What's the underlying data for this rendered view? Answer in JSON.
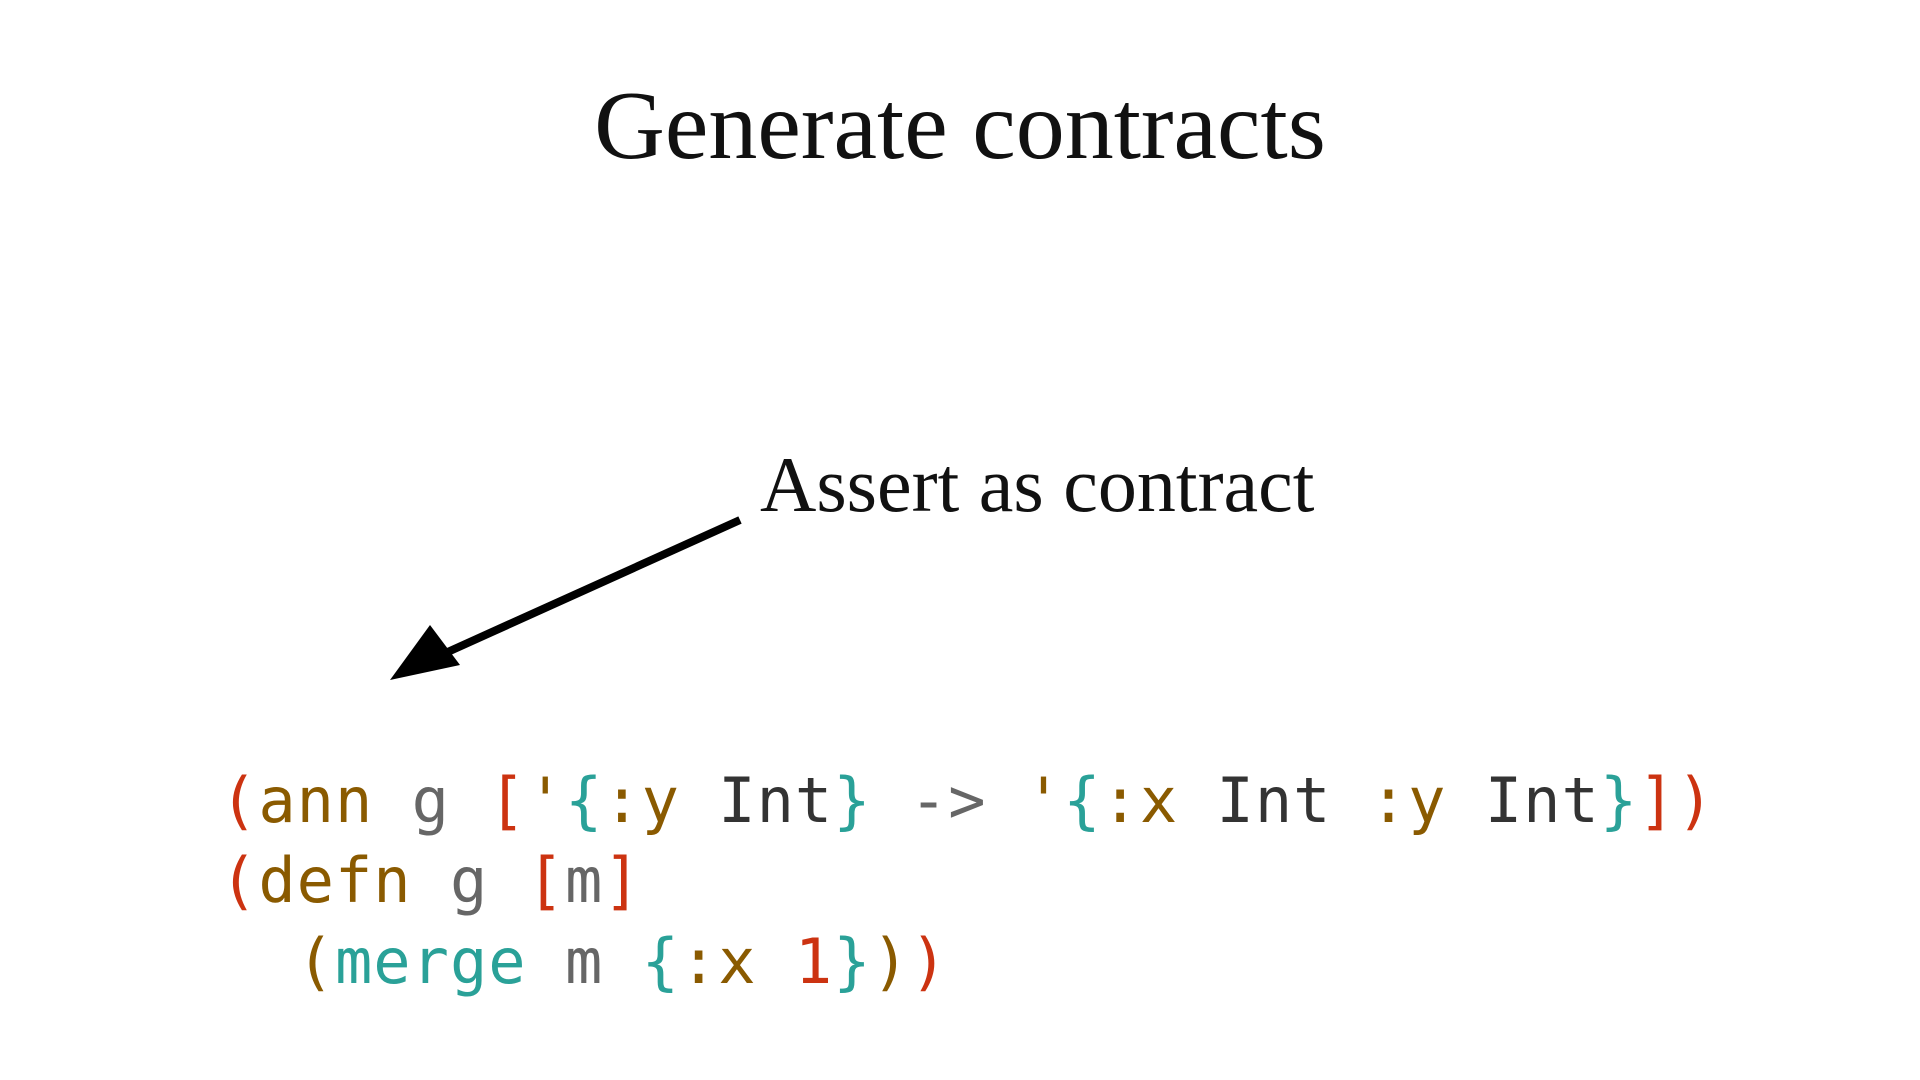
{
  "title": "Generate contracts",
  "annotation": "Assert as contract",
  "code": {
    "line1": {
      "p1": "(",
      "p2": "ann",
      "p3": " g ",
      "p4": "[",
      "p5": "'",
      "p6": "{",
      "p7": ":y",
      "p8": " Int",
      "p9": "}",
      "p10": " -> ",
      "p11": "'",
      "p12": "{",
      "p13": ":x",
      "p14": " Int ",
      "p15": ":y",
      "p16": " Int",
      "p17": "}",
      "p18": "]",
      "p19": ")"
    },
    "line2": {
      "p1": "(",
      "p2": "defn",
      "p3": " g ",
      "p4": "[",
      "p5": "m",
      "p6": "]"
    },
    "line3": {
      "p0": "  ",
      "p1": "(",
      "p2": "merge",
      "p3": " m ",
      "p4": "{",
      "p5": ":x",
      "p6": " ",
      "p7": "1",
      "p8": "}",
      "p9": ")",
      "p10": ")"
    }
  }
}
